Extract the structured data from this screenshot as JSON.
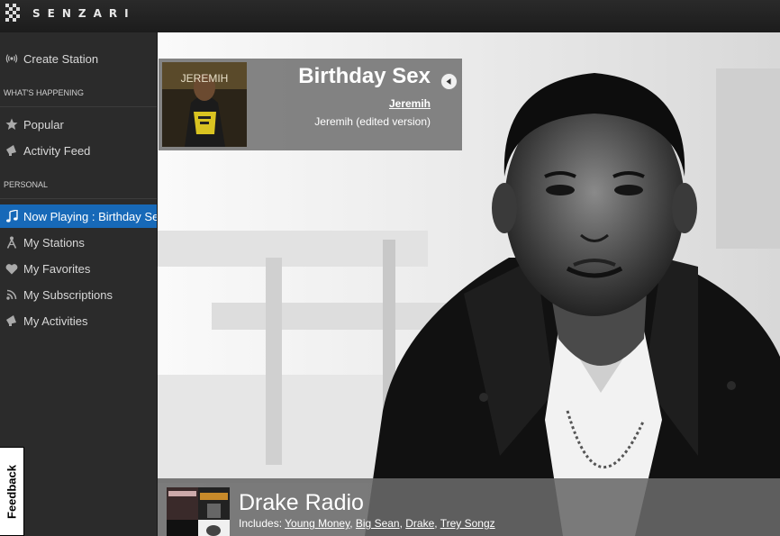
{
  "app": {
    "brand": "SENZARI"
  },
  "sidebar": {
    "create_station": "Create Station",
    "section_happening": "WHAT'S HAPPENING",
    "popular": "Popular",
    "activity_feed": "Activity Feed",
    "section_personal": "PERSONAL",
    "now_playing": "Now Playing : Birthday Sex",
    "my_stations": "My Stations",
    "my_favorites": "My Favorites",
    "my_subscriptions": "My Subscriptions",
    "my_activities": "My Activities"
  },
  "feedback": {
    "label": "Feedback"
  },
  "now_playing": {
    "title": "Birthday Sex",
    "artist": "Jeremih",
    "album": "Jeremih (edited version)",
    "album_art_text": "JEREMIH"
  },
  "station": {
    "name": "Drake Radio",
    "includes_label": "Includes:",
    "artists": [
      "Young Money",
      "Big Sean",
      "Drake",
      "Trey Songz"
    ]
  },
  "colors": {
    "accent": "#1769b8",
    "sidebar_bg": "#2b2b2b",
    "topbar_bg": "#1c1c1c"
  }
}
